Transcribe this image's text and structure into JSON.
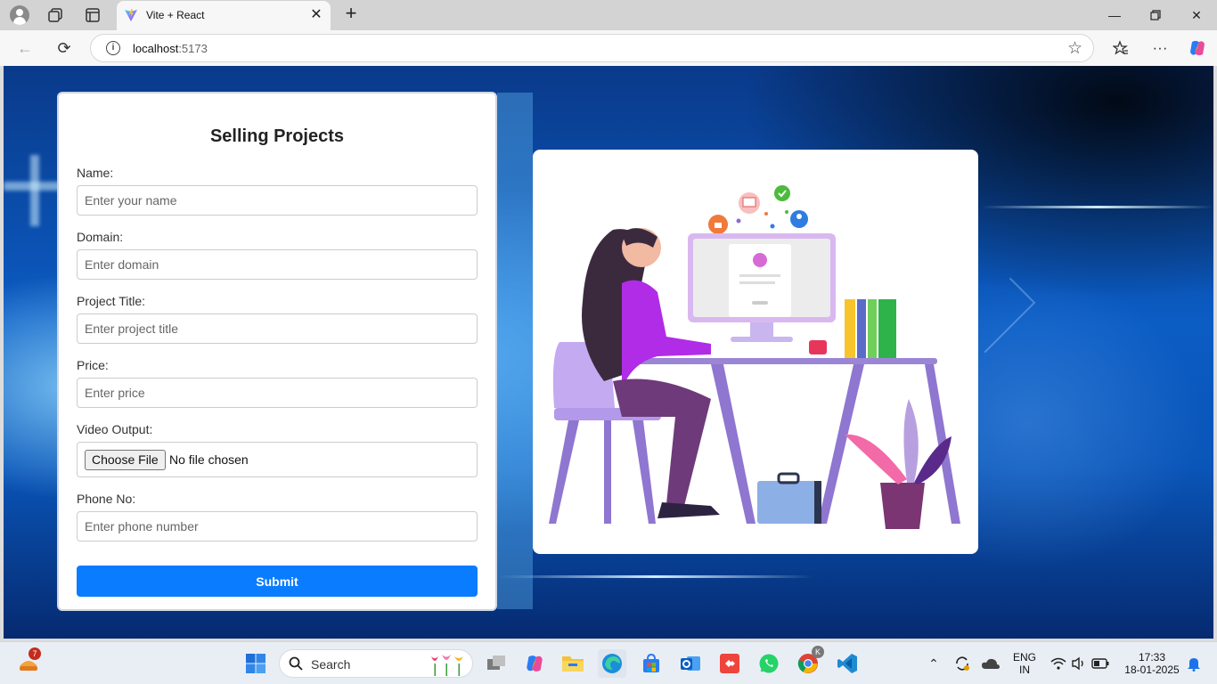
{
  "browser": {
    "tab_title": "Vite + React",
    "url_host": "localhost",
    "url_port": ":5173"
  },
  "form": {
    "title": "Selling Projects",
    "fields": [
      {
        "label": "Name:",
        "placeholder": "Enter your name"
      },
      {
        "label": "Domain:",
        "placeholder": "Enter domain"
      },
      {
        "label": "Project Title:",
        "placeholder": "Enter project title"
      },
      {
        "label": "Price:",
        "placeholder": "Enter price"
      },
      {
        "label": "Video Output:",
        "button": "Choose File",
        "status": "No file chosen"
      },
      {
        "label": "Phone No:",
        "placeholder": "Enter phone number"
      }
    ],
    "submit_label": "Submit"
  },
  "taskbar": {
    "search_label": "Search",
    "notification_count": "7",
    "chrome_badge": "K",
    "lang_line1": "ENG",
    "lang_line2": "IN",
    "time": "17:33",
    "date": "18-01-2025"
  },
  "colors": {
    "accent": "#0a7cff",
    "page_background": "#0b5cc4"
  }
}
